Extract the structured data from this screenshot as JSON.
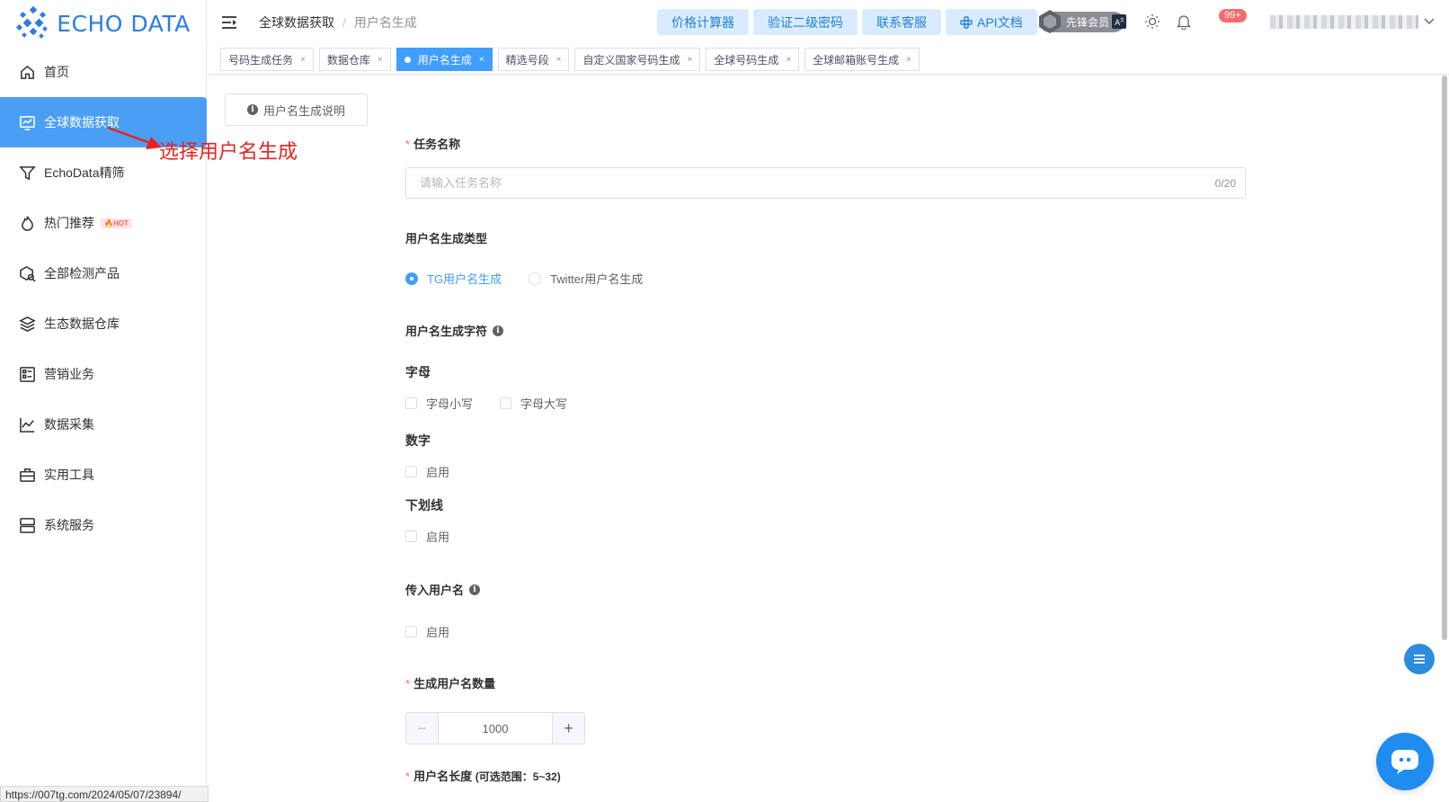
{
  "logo": {
    "text": "ECHO DATA"
  },
  "sidebar": {
    "items": [
      {
        "label": "首页",
        "icon": "home-icon",
        "active": false
      },
      {
        "label": "全球数据获取",
        "icon": "chart-monitor-icon",
        "active": true
      },
      {
        "label": "EchoData精筛",
        "icon": "filter-icon",
        "active": false
      },
      {
        "label": "热门推荐",
        "icon": "flame-icon",
        "active": false,
        "badge": "🔥HOT"
      },
      {
        "label": "全部检测产品",
        "icon": "box-search-icon",
        "active": false
      },
      {
        "label": "生态数据仓库",
        "icon": "layers-icon",
        "active": false
      },
      {
        "label": "营销业务",
        "icon": "list-icon",
        "active": false
      },
      {
        "label": "数据采集",
        "icon": "line-chart-icon",
        "active": false
      },
      {
        "label": "实用工具",
        "icon": "briefcase-icon",
        "active": false
      },
      {
        "label": "系统服务",
        "icon": "server-icon",
        "active": false
      }
    ]
  },
  "status_url": "https://007tg.com/2024/05/07/23894/",
  "header": {
    "breadcrumb": [
      "全球数据获取",
      "用户名生成"
    ],
    "separator": "/",
    "buttons": [
      "价格计算器",
      "验证二级密码",
      "联系客服",
      "API文档"
    ],
    "vip_label": "先锋会员",
    "notification_count": "99+"
  },
  "tabs": [
    {
      "label": "号码生成任务",
      "active": false
    },
    {
      "label": "数据仓库",
      "active": false
    },
    {
      "label": "用户名生成",
      "active": true
    },
    {
      "label": "精选号段",
      "active": false
    },
    {
      "label": "自定义国家号码生成",
      "active": false
    },
    {
      "label": "全球号码生成",
      "active": false
    },
    {
      "label": "全球邮箱账号生成",
      "active": false
    }
  ],
  "help_button": "用户名生成说明",
  "annotation": "选择用户名生成",
  "form": {
    "task_name": {
      "label": "任务名称",
      "placeholder": "请输入任务名称",
      "counter": "0/20"
    },
    "gen_type": {
      "label": "用户名生成类型",
      "options": [
        "TG用户名生成",
        "Twitter用户名生成"
      ],
      "selected": 0
    },
    "chars": {
      "label": "用户名生成字符"
    },
    "letters": {
      "label": "字母",
      "options": [
        "字母小写",
        "字母大写"
      ]
    },
    "digits": {
      "label": "数字",
      "option": "启用"
    },
    "underscore": {
      "label": "下划线",
      "option": "启用"
    },
    "input_usernames": {
      "label": "传入用户名",
      "option": "启用"
    },
    "quantity": {
      "label": "生成用户名数量",
      "value": "1000"
    },
    "length": {
      "label": "用户名长度",
      "range_note": "(可选范围：5~32)"
    }
  },
  "colors": {
    "primary": "#409eff",
    "active_nav": "#4a9ff5",
    "annotation": "#e8231f",
    "danger": "#f56c6c"
  }
}
